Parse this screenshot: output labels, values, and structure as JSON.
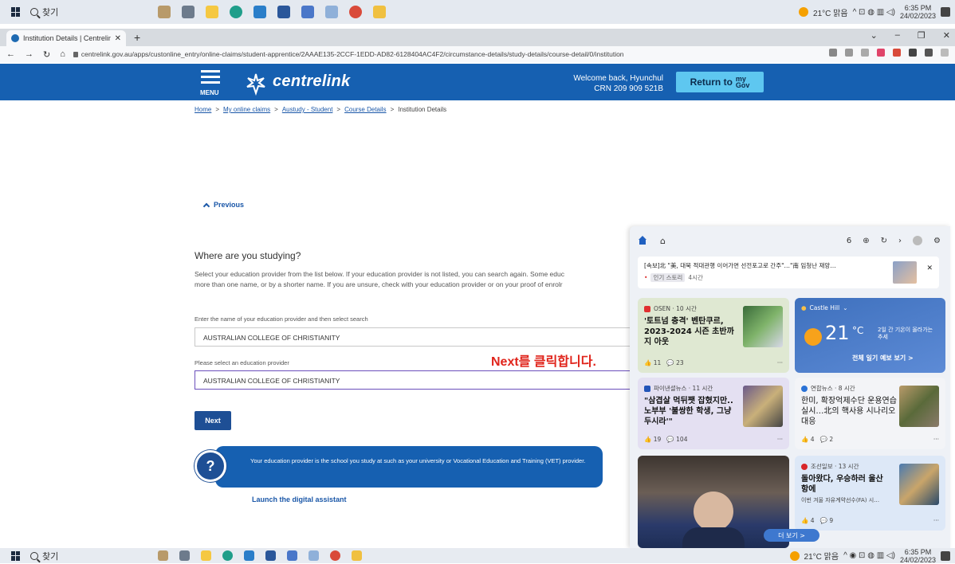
{
  "taskbar": {
    "search_label": "찾기",
    "weather_text": "21°C 맑음",
    "time": "6:35 PM",
    "date": "24/02/2023"
  },
  "browser": {
    "tab_title": "Institution Details | Centrelink O",
    "url": "centrelink.gov.au/apps/custonline_entry/online-claims/student-apprentice/2AAAE135-2CCF-1EDD-AD82-6128404AC4F2/circumstance-details/study-details/course-detail/0/institution"
  },
  "header": {
    "menu_label": "MENU",
    "brand": "centrelink",
    "welcome_line1": "Welcome back, Hyunchul",
    "welcome_line2": "CRN 209 909 521B",
    "return_label": "Return to",
    "mygov_top": "my",
    "mygov_bottom": "Gov"
  },
  "breadcrumb": {
    "items": [
      "Home",
      "My online claims",
      "Austudy - Student",
      "Course Details"
    ],
    "current": "Institution Details",
    "sep": ">"
  },
  "form": {
    "previous_label": "Previous",
    "question": "Where are you studying?",
    "desc_line1": "Select your education provider from the list below. If your education provider is not listed, you can search again. Some educ",
    "desc_line2": "more than one name, or by a shorter name. If you are unsure, check with your education provider or on your proof of enrolr",
    "search_label": "Enter the name of your education provider and then select search",
    "search_value": "AUSTRALIAN COLLEGE OF CHRISTIANITY",
    "select_label": "Please select an education provider",
    "select_value": "AUSTRALIAN COLLEGE OF CHRISTIANITY",
    "next_label": "Next",
    "annotation": "Next를 클릭합니다."
  },
  "assistant": {
    "icon": "?",
    "bubble_text": "Your education provider is the school you study at such as your university or Vocational Education and Training (VET) provider.",
    "link": "Launch the digital assistant"
  },
  "widget": {
    "top_count": "6",
    "alert_headline": "[속보]北 \"美, 대북 적대관행 이어가면 선전포고로 간주\"…\"南 임청난 재앙…",
    "alert_pill": "인기 스토리",
    "alert_time": "4시간",
    "card1": {
      "source": "OSEN · 10 시간",
      "title": "'토트넘 충격' 벤탄쿠르, 2023-2024 시즌 초반까지 아웃",
      "likes": "11",
      "comments": "23"
    },
    "weather": {
      "location": "Castle Hill",
      "temp": "21",
      "unit": "°C",
      "note": "2일 간 기온이 올라가는 추세",
      "forecast": "전체 일기 예보 보기 >"
    },
    "card2": {
      "source": "파이낸셜뉴스 · 11 시간",
      "title": "\"삼겹살 먹뒤쨋 잡혔지만..노부부 '불쌍한 학생, 그냥 두시라'\"",
      "likes": "19",
      "comments": "104"
    },
    "card3": {
      "source": "연합뉴스 · 8 시간",
      "title": "한미, 확장억제수단 운용연습 실시…北의 핵사용 시나리오 대응",
      "likes": "4",
      "comments": "2"
    },
    "card4": {
      "source": "조선일보 · 13 시간",
      "title": "돌아왔다, 우승하러 울산항에",
      "snippet": "이번 겨울 자유계약선수(FA) 시…",
      "likes": "4",
      "comments": "9"
    },
    "more_label": "더 보기 >"
  }
}
